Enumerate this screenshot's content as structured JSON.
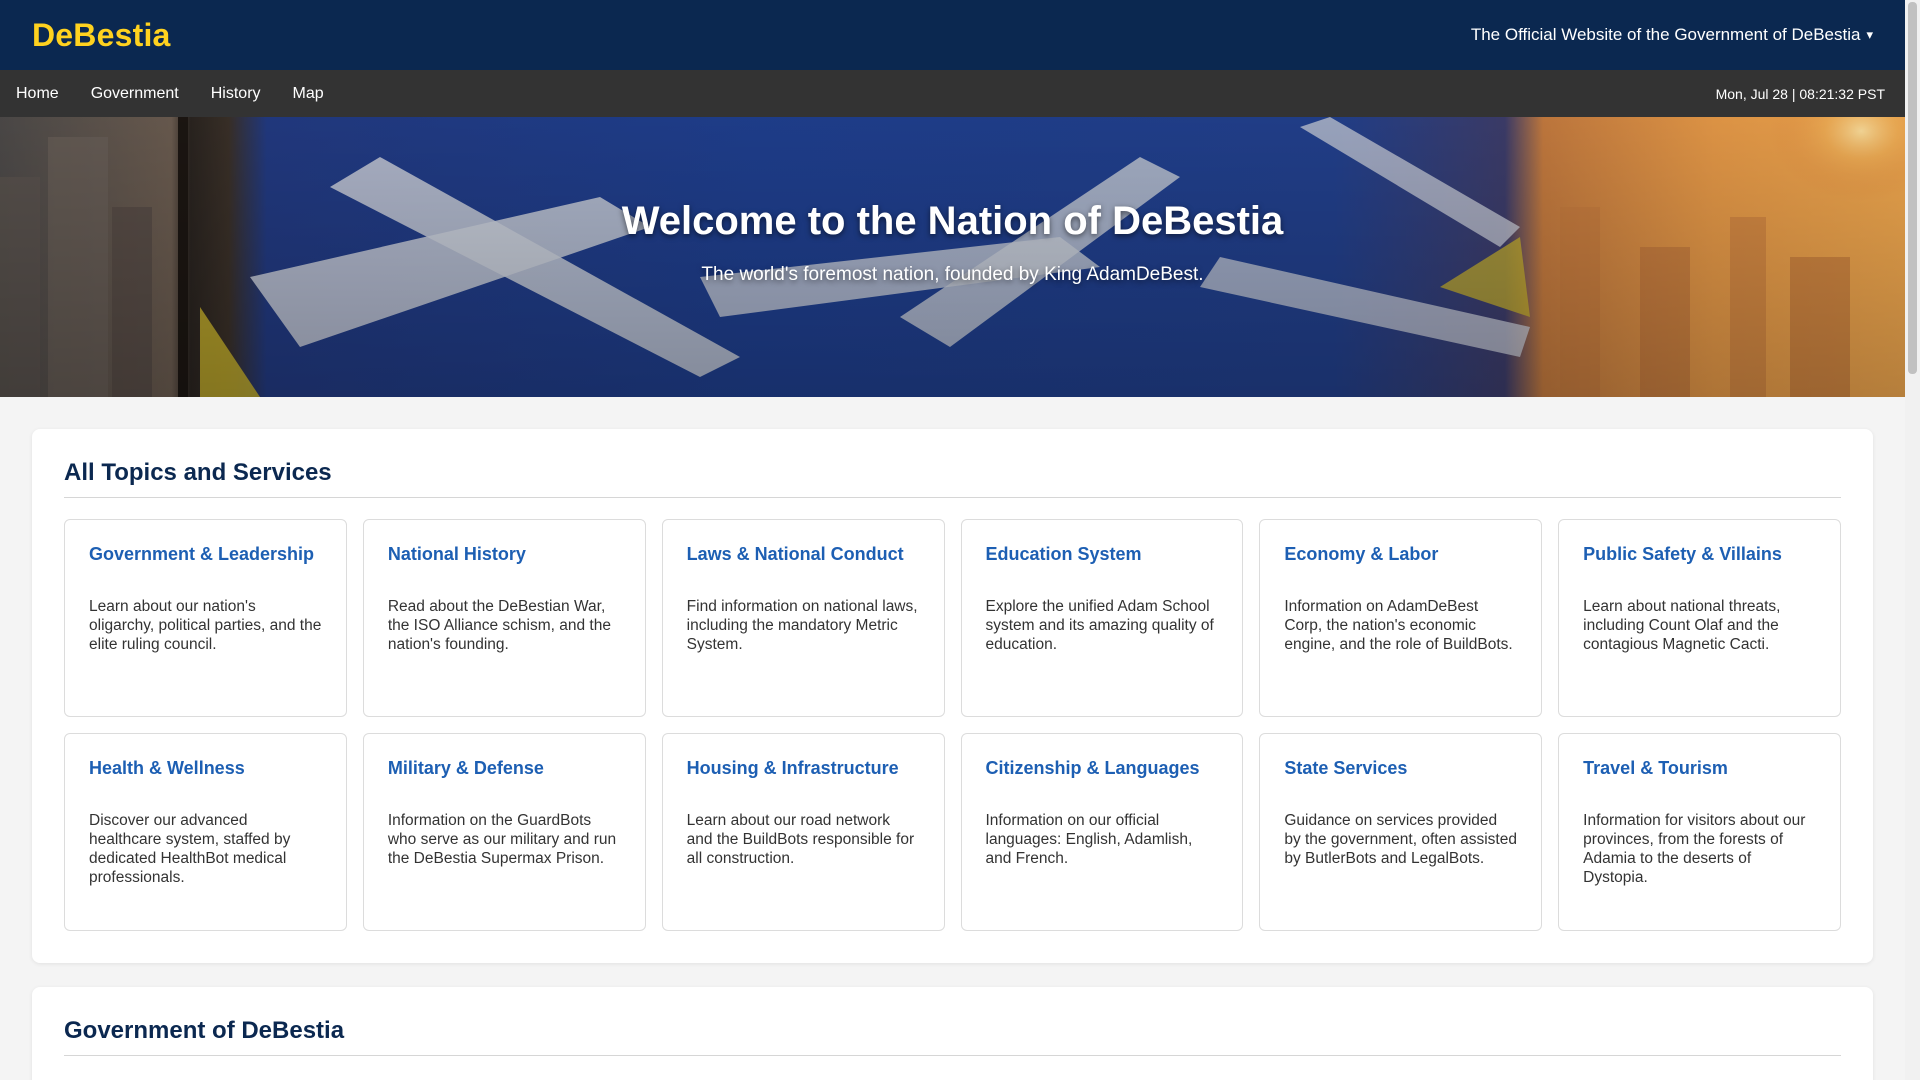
{
  "header": {
    "brand": "DeBestia",
    "official_label": "The Official Website of the Government of DeBestia",
    "caret": "▾"
  },
  "nav": {
    "links": [
      "Home",
      "Government",
      "History",
      "Map"
    ],
    "clock": "Mon, Jul 28 | 08:21:32 PST"
  },
  "hero": {
    "title": "Welcome to the Nation of DeBestia",
    "subtitle": "The world's foremost nation, founded by King AdamDeBest."
  },
  "topics": {
    "title": "All Topics and Services",
    "cards": [
      {
        "title": "Government & Leadership",
        "desc": "Learn about our nation's oligarchy, political parties, and the elite ruling council."
      },
      {
        "title": "National History",
        "desc": "Read about the DeBestian War, the ISO Alliance schism, and the nation's founding."
      },
      {
        "title": "Laws & National Conduct",
        "desc": "Find information on national laws, including the mandatory Metric System."
      },
      {
        "title": "Education System",
        "desc": "Explore the unified Adam School system and its amazing quality of education."
      },
      {
        "title": "Economy & Labor",
        "desc": "Information on AdamDeBest Corp, the nation's economic engine, and the role of BuildBots."
      },
      {
        "title": "Public Safety & Villains",
        "desc": "Learn about national threats, including Count Olaf and the contagious Magnetic Cacti."
      },
      {
        "title": "Health & Wellness",
        "desc": "Discover our advanced healthcare system, staffed by dedicated HealthBot medical professionals."
      },
      {
        "title": "Military & Defense",
        "desc": "Information on the GuardBots who serve as our military and run the DeBestia Supermax Prison."
      },
      {
        "title": "Housing & Infrastructure",
        "desc": "Learn about our road network and the BuildBots responsible for all construction."
      },
      {
        "title": "Citizenship & Languages",
        "desc": "Information on our official languages: English, Adamlish, and French."
      },
      {
        "title": "State Services",
        "desc": "Guidance on services provided by the government, often assisted by ButlerBots and LegalBots."
      },
      {
        "title": "Travel & Tourism",
        "desc": "Information for visitors about our provinces, from the forests of Adamia to the deserts of Dystopia."
      }
    ]
  },
  "government_section": {
    "title": "Government of DeBestia"
  }
}
